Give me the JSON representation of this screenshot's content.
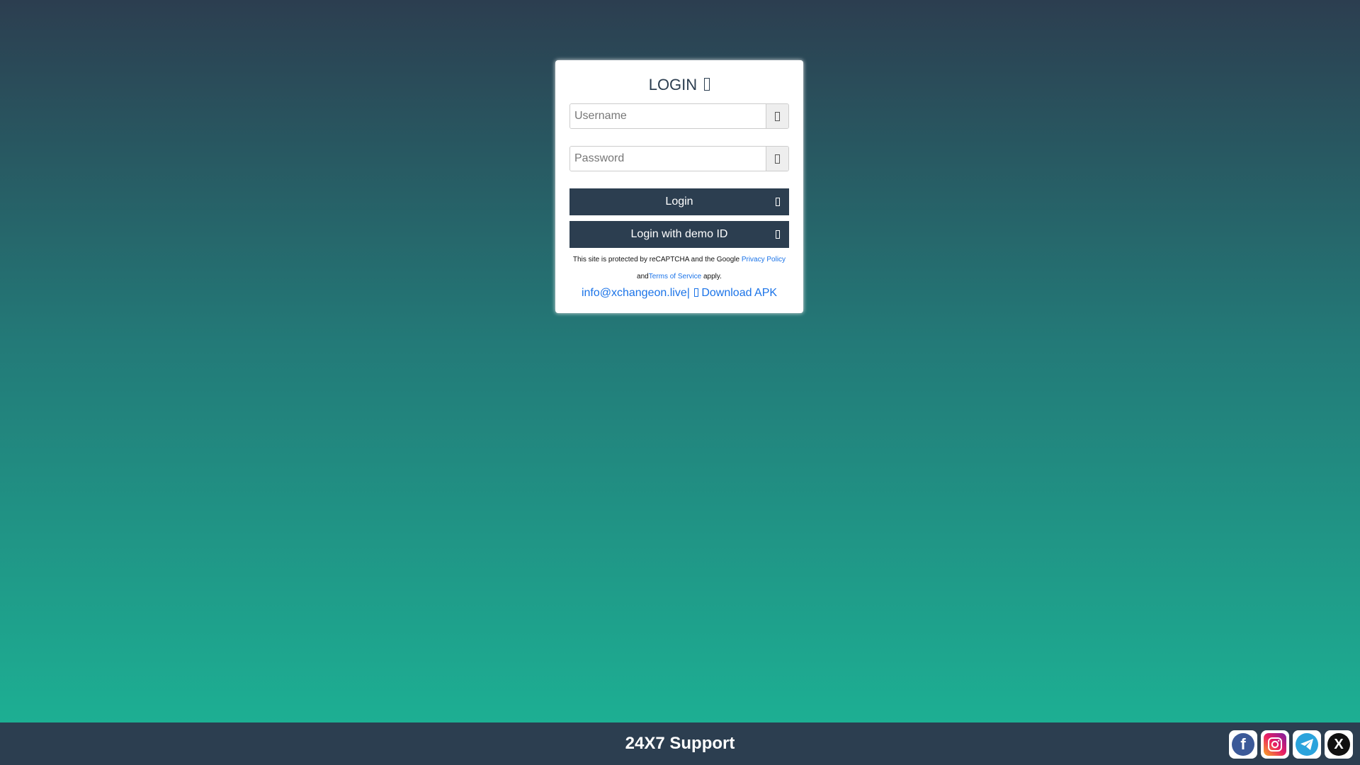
{
  "login": {
    "title": "LOGIN",
    "username_placeholder": "Username",
    "password_placeholder": "Password",
    "login_button": "Login",
    "demo_button": "Login with demo ID",
    "recaptcha_prefix": "This site is protected by reCAPTCHA and the Google ",
    "privacy_policy": "Privacy Policy",
    "recaptcha_and": "and",
    "terms_of_service": "Terms of Service",
    "recaptcha_suffix": " apply.",
    "email": "info@xchangeon.live",
    "separator": "|",
    "download_apk": "Download APK"
  },
  "footer": {
    "title": "24X7 Support",
    "socials": [
      {
        "name": "facebook-icon",
        "glyph": "f"
      },
      {
        "name": "instagram-icon",
        "glyph": ""
      },
      {
        "name": "telegram-icon",
        "glyph": ""
      },
      {
        "name": "x-twitter-icon",
        "glyph": "X"
      }
    ]
  },
  "colors": {
    "primary": "#2c3e50",
    "gradient_bottom": "#1cb596",
    "link": "#1a73e8"
  }
}
